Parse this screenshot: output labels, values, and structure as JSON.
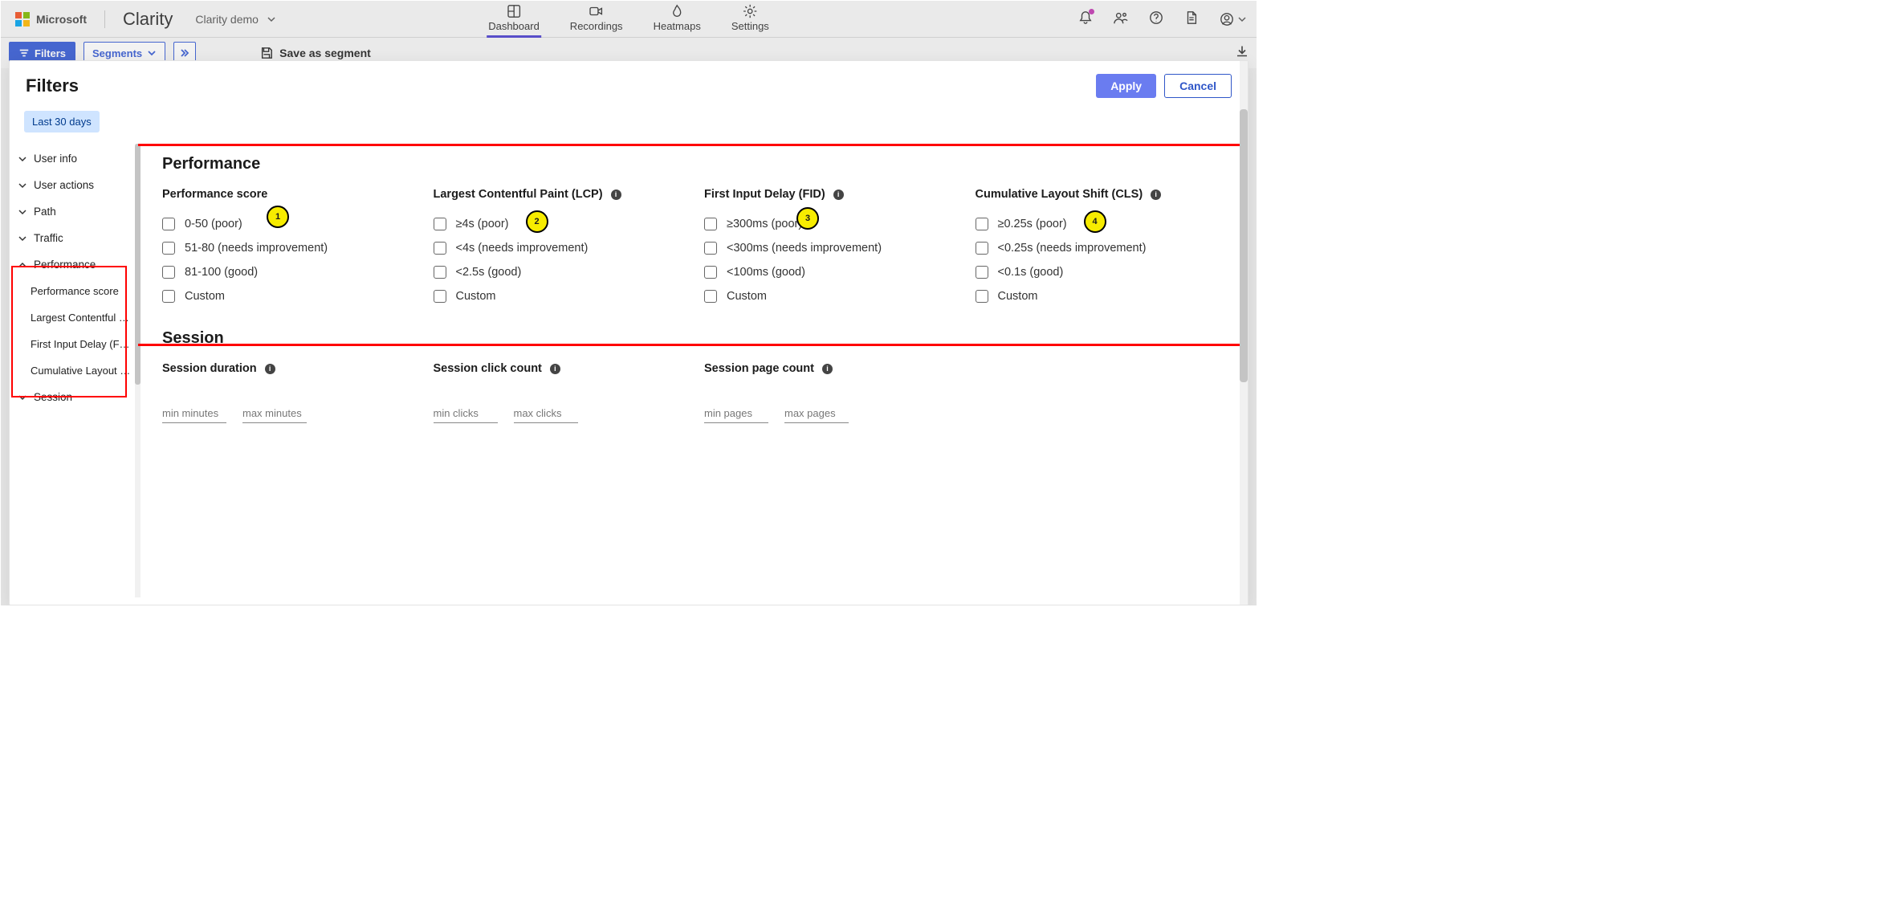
{
  "header": {
    "brand_ms": "Microsoft",
    "brand_app": "Clarity",
    "project": "Clarity demo",
    "nav": {
      "dashboard": "Dashboard",
      "recordings": "Recordings",
      "heatmaps": "Heatmaps",
      "settings": "Settings"
    }
  },
  "secondbar": {
    "filters_label": "Filters",
    "segments_label": "Segments",
    "save_label": "Save as segment"
  },
  "modal": {
    "title": "Filters",
    "apply": "Apply",
    "cancel": "Cancel",
    "date_chip": "Last 30 days"
  },
  "sidebar": {
    "items": [
      "User info",
      "User actions",
      "Path",
      "Traffic",
      "Performance",
      "Session"
    ],
    "perf_children": [
      "Performance score",
      "Largest Contentful Pain…",
      "First Input Delay (FID)",
      "Cumulative Layout Shif…"
    ]
  },
  "performance": {
    "section_title": "Performance",
    "cols": [
      {
        "title": "Performance score",
        "info": false,
        "opts": [
          "0-50 (poor)",
          "51-80 (needs improvement)",
          "81-100 (good)",
          "Custom"
        ]
      },
      {
        "title": "Largest Contentful Paint (LCP)",
        "info": true,
        "opts": [
          "≥4s (poor)",
          "<4s (needs improvement)",
          "<2.5s (good)",
          "Custom"
        ]
      },
      {
        "title": "First Input Delay (FID)",
        "info": true,
        "opts": [
          "≥300ms (poor)",
          "<300ms (needs improvement)",
          "<100ms (good)",
          "Custom"
        ]
      },
      {
        "title": "Cumulative Layout Shift (CLS)",
        "info": true,
        "opts": [
          "≥0.25s (poor)",
          "<0.25s (needs improvement)",
          "<0.1s (good)",
          "Custom"
        ]
      }
    ],
    "callouts": [
      "1",
      "2",
      "3",
      "4"
    ]
  },
  "session": {
    "section_title": "Session",
    "cols": [
      {
        "title": "Session duration",
        "ph1": "min minutes",
        "ph2": "max minutes"
      },
      {
        "title": "Session click count",
        "ph1": "min clicks",
        "ph2": "max clicks"
      },
      {
        "title": "Session page count",
        "ph1": "min pages",
        "ph2": "max pages"
      }
    ]
  }
}
